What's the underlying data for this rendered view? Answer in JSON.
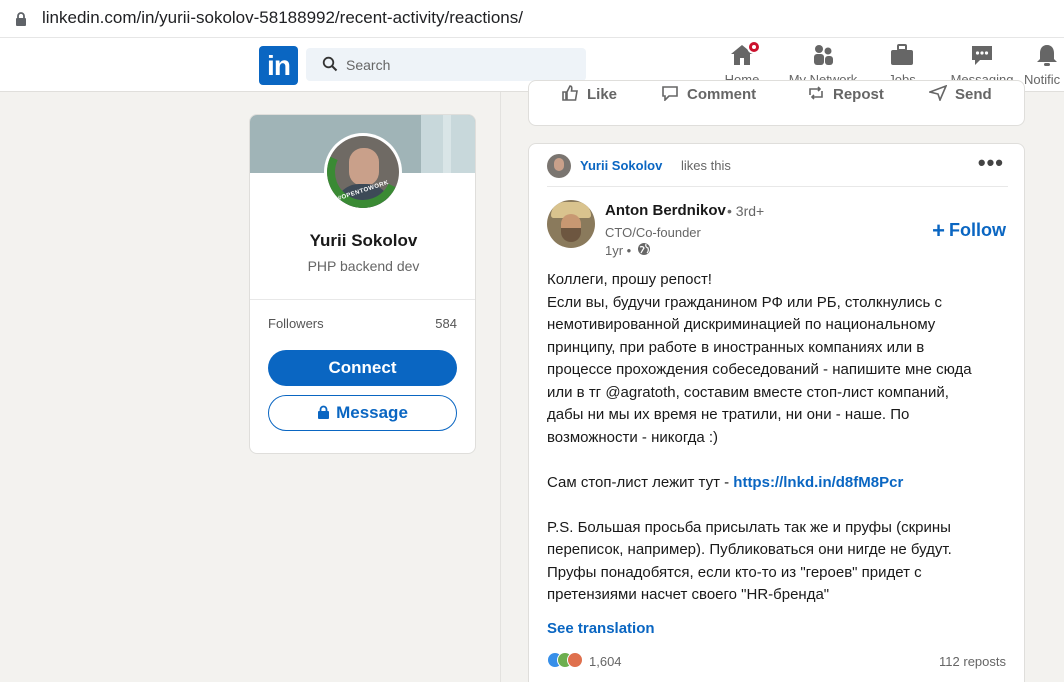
{
  "browser": {
    "url": "linkedin.com/in/yurii-sokolov-58188992/recent-activity/reactions/"
  },
  "nav": {
    "logo": "in",
    "search_placeholder": "Search",
    "items": [
      {
        "label": "Home",
        "icon": "home-icon"
      },
      {
        "label": "My Network",
        "icon": "network-icon"
      },
      {
        "label": "Jobs",
        "icon": "briefcase-icon"
      },
      {
        "label": "Messaging",
        "icon": "messaging-icon"
      },
      {
        "label": "Notific",
        "icon": "bell-icon"
      }
    ]
  },
  "profile": {
    "name": "Yurii Sokolov",
    "headline": "PHP backend dev",
    "badge_text": "#OPENTOWORK",
    "followers_label": "Followers",
    "followers_count": "584",
    "connect_label": "Connect",
    "message_label": "Message"
  },
  "previous_post": {
    "actions": [
      "Like",
      "Comment",
      "Repost",
      "Send"
    ]
  },
  "post": {
    "liker_name": "Yurii Sokolov",
    "liker_text": "likes this",
    "more": "•••",
    "author_name": "Anton Berdnikov",
    "author_degree": "• 3rd+",
    "author_role": "CTO/Co-founder",
    "time": "1yr •",
    "follow_label": "Follow",
    "lines": [
      "Коллеги, прошу репост!",
      "Если вы, будучи гражданином РФ или РБ, столкнулись с",
      "немотивированной дискриминацией по национальному",
      "принципу, при работе в иностранных компаниях или в",
      "процессе прохождения собеседований - напишите мне сюда",
      "или в тг @agratoth, составим вместе стоп-лист компаний,",
      "дабы ни мы их время не тратили, ни они - наше. По",
      "возможности - никогда :)"
    ],
    "link_prefix": "Сам стоп-лист лежит тут - ",
    "link_text": "https://lnkd.in/d8fM8Pcr",
    "ps_lines": [
      "P.S. Большая просьба присылать так же и пруфы (скрины",
      "переписок, например). Публиковаться они нигде не будут.",
      "Пруфы понадобятся, если кто-то из \"героев\" придет с",
      "претензиями насчет своего \"HR-бренда\""
    ],
    "see_translation": "See translation",
    "reactions_count": "1,604",
    "reposts": "112 reposts"
  },
  "colors": {
    "brand": "#0a66c2",
    "badge": "#cb112d",
    "open_to_work": "#3a8a34"
  }
}
